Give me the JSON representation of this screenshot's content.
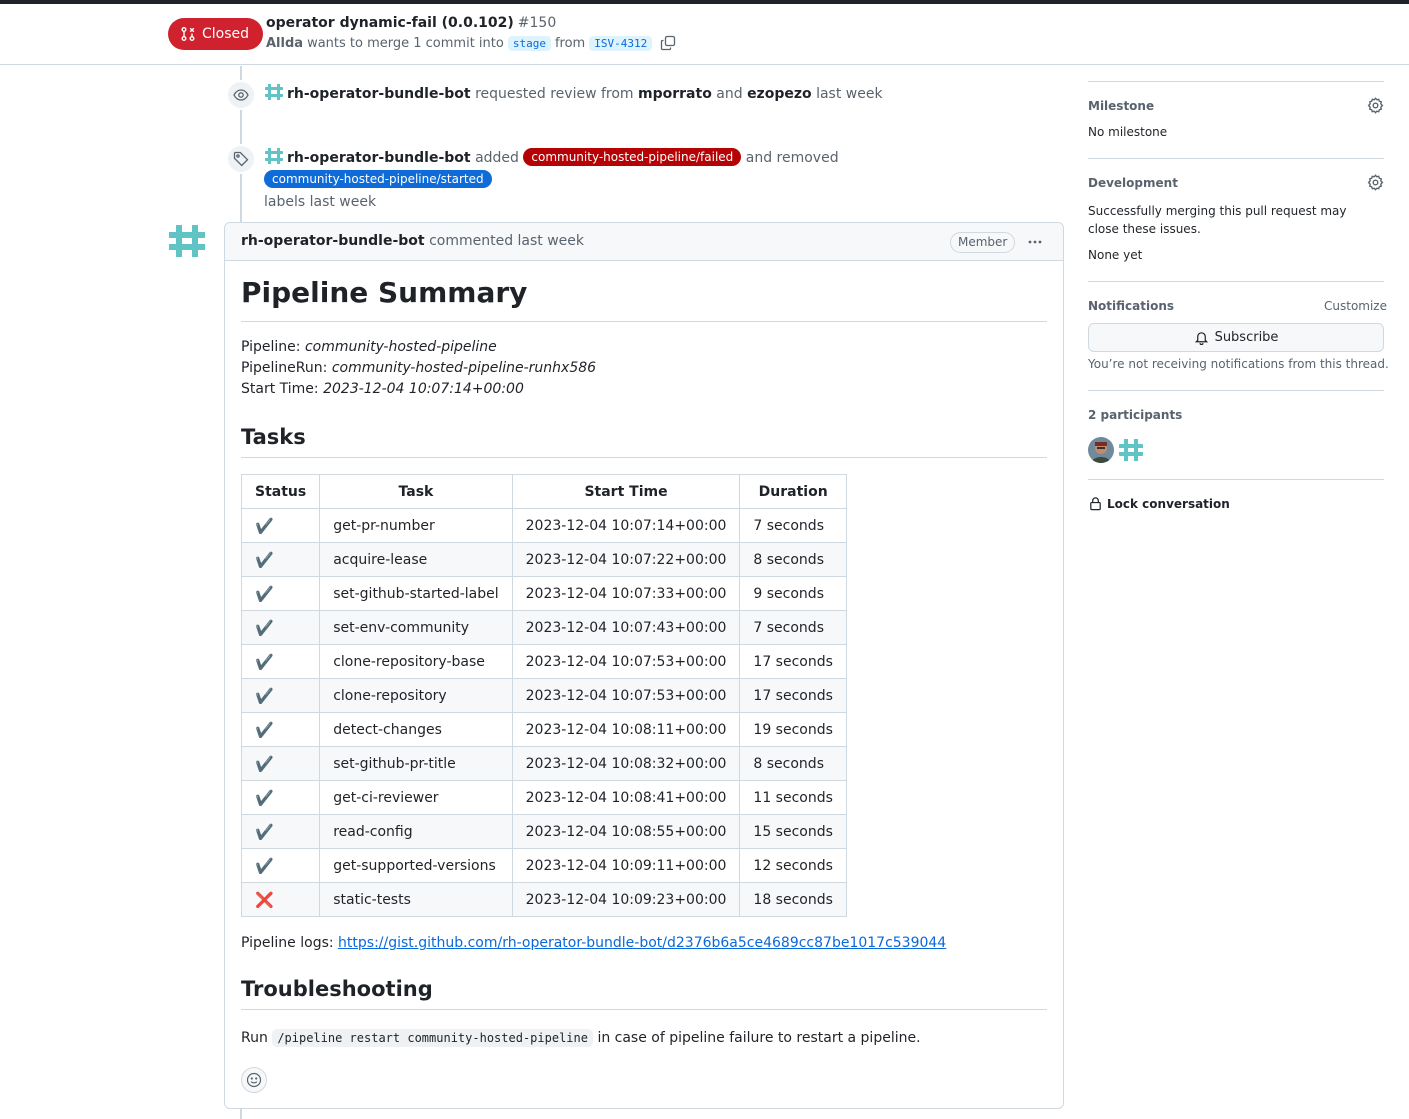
{
  "header": {
    "state": "Closed",
    "title": "operator dynamic-fail (0.0.102)",
    "number": "#150",
    "author": "Allda",
    "merge_text": "wants to merge 1 commit into",
    "base_branch": "stage",
    "from_text": "from",
    "head_branch": "ISV-4312"
  },
  "timeline": {
    "review_event": {
      "actor": "rh-operator-bundle-bot",
      "action": "requested review from",
      "reviewer1": "mporrato",
      "and": "and",
      "reviewer2": "ezopezo",
      "time": "last week"
    },
    "label_event": {
      "actor": "rh-operator-bundle-bot",
      "added": "added",
      "label_added": "community-hosted-pipeline/failed",
      "label_added_color": "#b60205",
      "and_removed": "and removed",
      "label_removed": "community-hosted-pipeline/started",
      "label_removed_color": "#0e6bd8",
      "suffix": "labels last week"
    }
  },
  "comment": {
    "author": "rh-operator-bundle-bot",
    "meta": "commented last week",
    "badge": "Member",
    "h1": "Pipeline Summary",
    "pipeline_label": "Pipeline:",
    "pipeline_value": "community-hosted-pipeline",
    "run_label": "PipelineRun:",
    "run_value": "community-hosted-pipeline-runhx586",
    "start_label": "Start Time:",
    "start_value": "2023-12-04 10:07:14+00:00",
    "tasks_heading": "Tasks",
    "table_headers": [
      "Status",
      "Task",
      "Start Time",
      "Duration"
    ],
    "tasks": [
      {
        "status": "✔️",
        "task": "get-pr-number",
        "start": "2023-12-04 10:07:14+00:00",
        "duration": "7 seconds"
      },
      {
        "status": "✔️",
        "task": "acquire-lease",
        "start": "2023-12-04 10:07:22+00:00",
        "duration": "8 seconds"
      },
      {
        "status": "✔️",
        "task": "set-github-started-label",
        "start": "2023-12-04 10:07:33+00:00",
        "duration": "9 seconds"
      },
      {
        "status": "✔️",
        "task": "set-env-community",
        "start": "2023-12-04 10:07:43+00:00",
        "duration": "7 seconds"
      },
      {
        "status": "✔️",
        "task": "clone-repository-base",
        "start": "2023-12-04 10:07:53+00:00",
        "duration": "17 seconds"
      },
      {
        "status": "✔️",
        "task": "clone-repository",
        "start": "2023-12-04 10:07:53+00:00",
        "duration": "17 seconds"
      },
      {
        "status": "✔️",
        "task": "detect-changes",
        "start": "2023-12-04 10:08:11+00:00",
        "duration": "19 seconds"
      },
      {
        "status": "✔️",
        "task": "set-github-pr-title",
        "start": "2023-12-04 10:08:32+00:00",
        "duration": "8 seconds"
      },
      {
        "status": "✔️",
        "task": "get-ci-reviewer",
        "start": "2023-12-04 10:08:41+00:00",
        "duration": "11 seconds"
      },
      {
        "status": "✔️",
        "task": "read-config",
        "start": "2023-12-04 10:08:55+00:00",
        "duration": "15 seconds"
      },
      {
        "status": "✔️",
        "task": "get-supported-versions",
        "start": "2023-12-04 10:09:11+00:00",
        "duration": "12 seconds"
      },
      {
        "status": "❌",
        "task": "static-tests",
        "start": "2023-12-04 10:09:23+00:00",
        "duration": "18 seconds"
      }
    ],
    "logs_label": "Pipeline logs:",
    "logs_url": "https://gist.github.com/rh-operator-bundle-bot/d2376b6a5ce4689cc87be1017c539044",
    "troubleshooting_heading": "Troubleshooting",
    "run_prefix": "Run",
    "run_command": "/pipeline restart community-hosted-pipeline",
    "run_suffix": "in case of pipeline failure to restart a pipeline."
  },
  "sidebar": {
    "milestone_heading": "Milestone",
    "milestone_value": "No milestone",
    "development_heading": "Development",
    "development_text": "Successfully merging this pull request may close these issues.",
    "development_value": "None yet",
    "notifications_heading": "Notifications",
    "customize": "Customize",
    "subscribe": "Subscribe",
    "notifications_text": "You’re not receiving notifications from this thread.",
    "participants_heading": "2 participants",
    "lock": "Lock conversation"
  },
  "colors": {
    "closed_red": "#cf222e",
    "link_blue": "#0969da",
    "bot_teal": "#5fc4c3"
  }
}
